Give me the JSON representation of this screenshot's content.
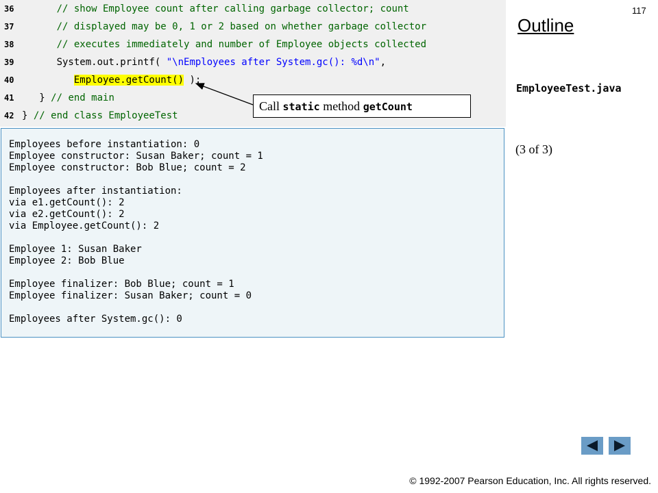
{
  "slide_number": "117",
  "outline": {
    "title": "Outline",
    "file_name": "EmployeeTest.java",
    "page_indicator": "(3 of 3)"
  },
  "code_lines": [
    {
      "num": "36",
      "indent": "      ",
      "parts": [
        {
          "t": "// show Employee count after calling garbage collector; count",
          "c": "cm"
        }
      ]
    },
    {
      "num": "37",
      "indent": "      ",
      "parts": [
        {
          "t": "// displayed may be 0, 1 or 2 based on whether garbage collector",
          "c": "cm"
        }
      ]
    },
    {
      "num": "38",
      "indent": "      ",
      "parts": [
        {
          "t": "// executes immediately and number of Employee objects collected",
          "c": "cm"
        }
      ]
    },
    {
      "num": "39",
      "indent": "      ",
      "parts": [
        {
          "t": "System.out.printf( ",
          "c": ""
        },
        {
          "t": "\"\\nEmployees after System.gc(): %d\\n\"",
          "c": "st"
        },
        {
          "t": ",",
          "c": ""
        }
      ]
    },
    {
      "num": "40",
      "indent": "         ",
      "parts": [
        {
          "t": "Employee.getCount()",
          "c": "hl"
        },
        {
          "t": " );",
          "c": ""
        }
      ]
    },
    {
      "num": "41",
      "indent": "   ",
      "parts": [
        {
          "t": "} ",
          "c": ""
        },
        {
          "t": "// end main",
          "c": "cm"
        }
      ]
    },
    {
      "num": "42",
      "indent": "",
      "parts": [
        {
          "t": "} ",
          "c": ""
        },
        {
          "t": "// end class EmployeeTest",
          "c": "cm"
        }
      ]
    }
  ],
  "callout": {
    "prefix": "Call ",
    "keyword": "static",
    "middle": " method ",
    "method": "getCount"
  },
  "output_lines": [
    "Employees before instantiation: 0",
    "Employee constructor: Susan Baker; count = 1",
    "Employee constructor: Bob Blue; count = 2",
    "",
    "Employees after instantiation:",
    "via e1.getCount(): 2",
    "via e2.getCount(): 2",
    "via Employee.getCount(): 2",
    "",
    "Employee 1: Susan Baker",
    "Employee 2: Bob Blue",
    "",
    "Employee finalizer: Bob Blue; count = 1",
    "Employee finalizer: Susan Baker; count = 0",
    "",
    "Employees after System.gc(): 0"
  ],
  "nav": {
    "prev_icon": "triangle-left-icon",
    "next_icon": "triangle-right-icon",
    "button_color": "#6a9cc6"
  },
  "footer": {
    "copyright": "© 1992-2007 Pearson Education, Inc.  All rights reserved."
  }
}
